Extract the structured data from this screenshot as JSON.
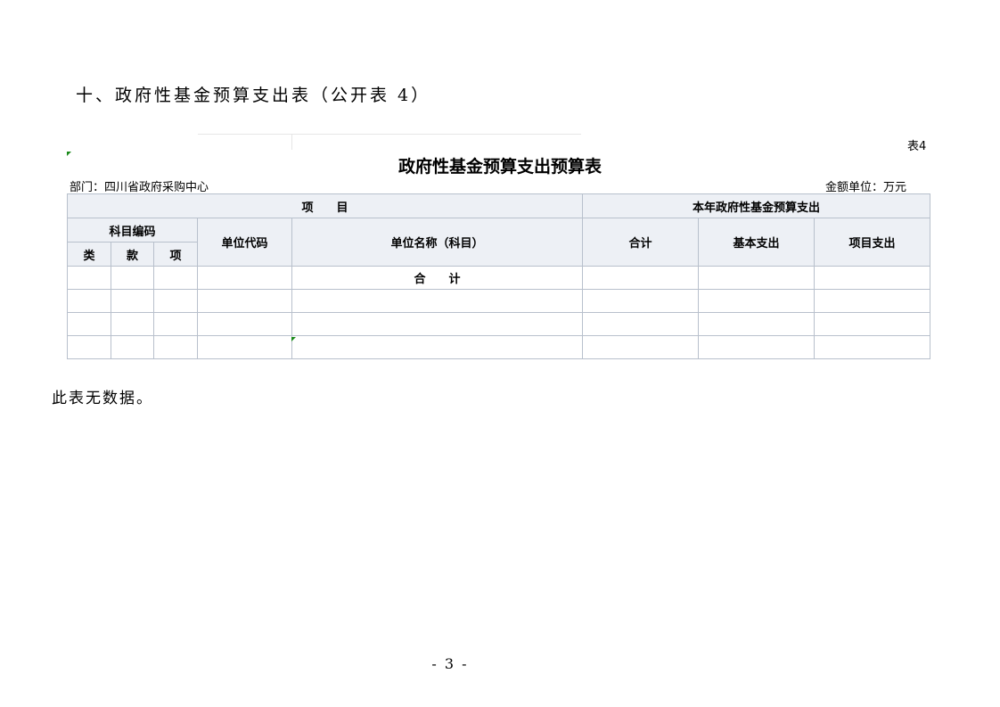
{
  "section": {
    "heading": "十、政府性基金预算支出表（公开表 4）"
  },
  "table": {
    "number": "表4",
    "title": "政府性基金预算支出预算表",
    "department": "部门：四川省政府采购中心",
    "unit": "金额单位：万元",
    "headers": {
      "project": "项　　目",
      "current_year": "本年政府性基金预算支出",
      "subject_code": "科目编码",
      "unit_code": "单位代码",
      "unit_name": "单位名称（科目）",
      "total": "合计",
      "basic": "基本支出",
      "project_expense": "项目支出",
      "category": "类",
      "section": "款",
      "item": "项"
    },
    "total_row_label": "合　　计"
  },
  "note": "此表无数据。",
  "footer": {
    "page_number": "- 3 -"
  }
}
